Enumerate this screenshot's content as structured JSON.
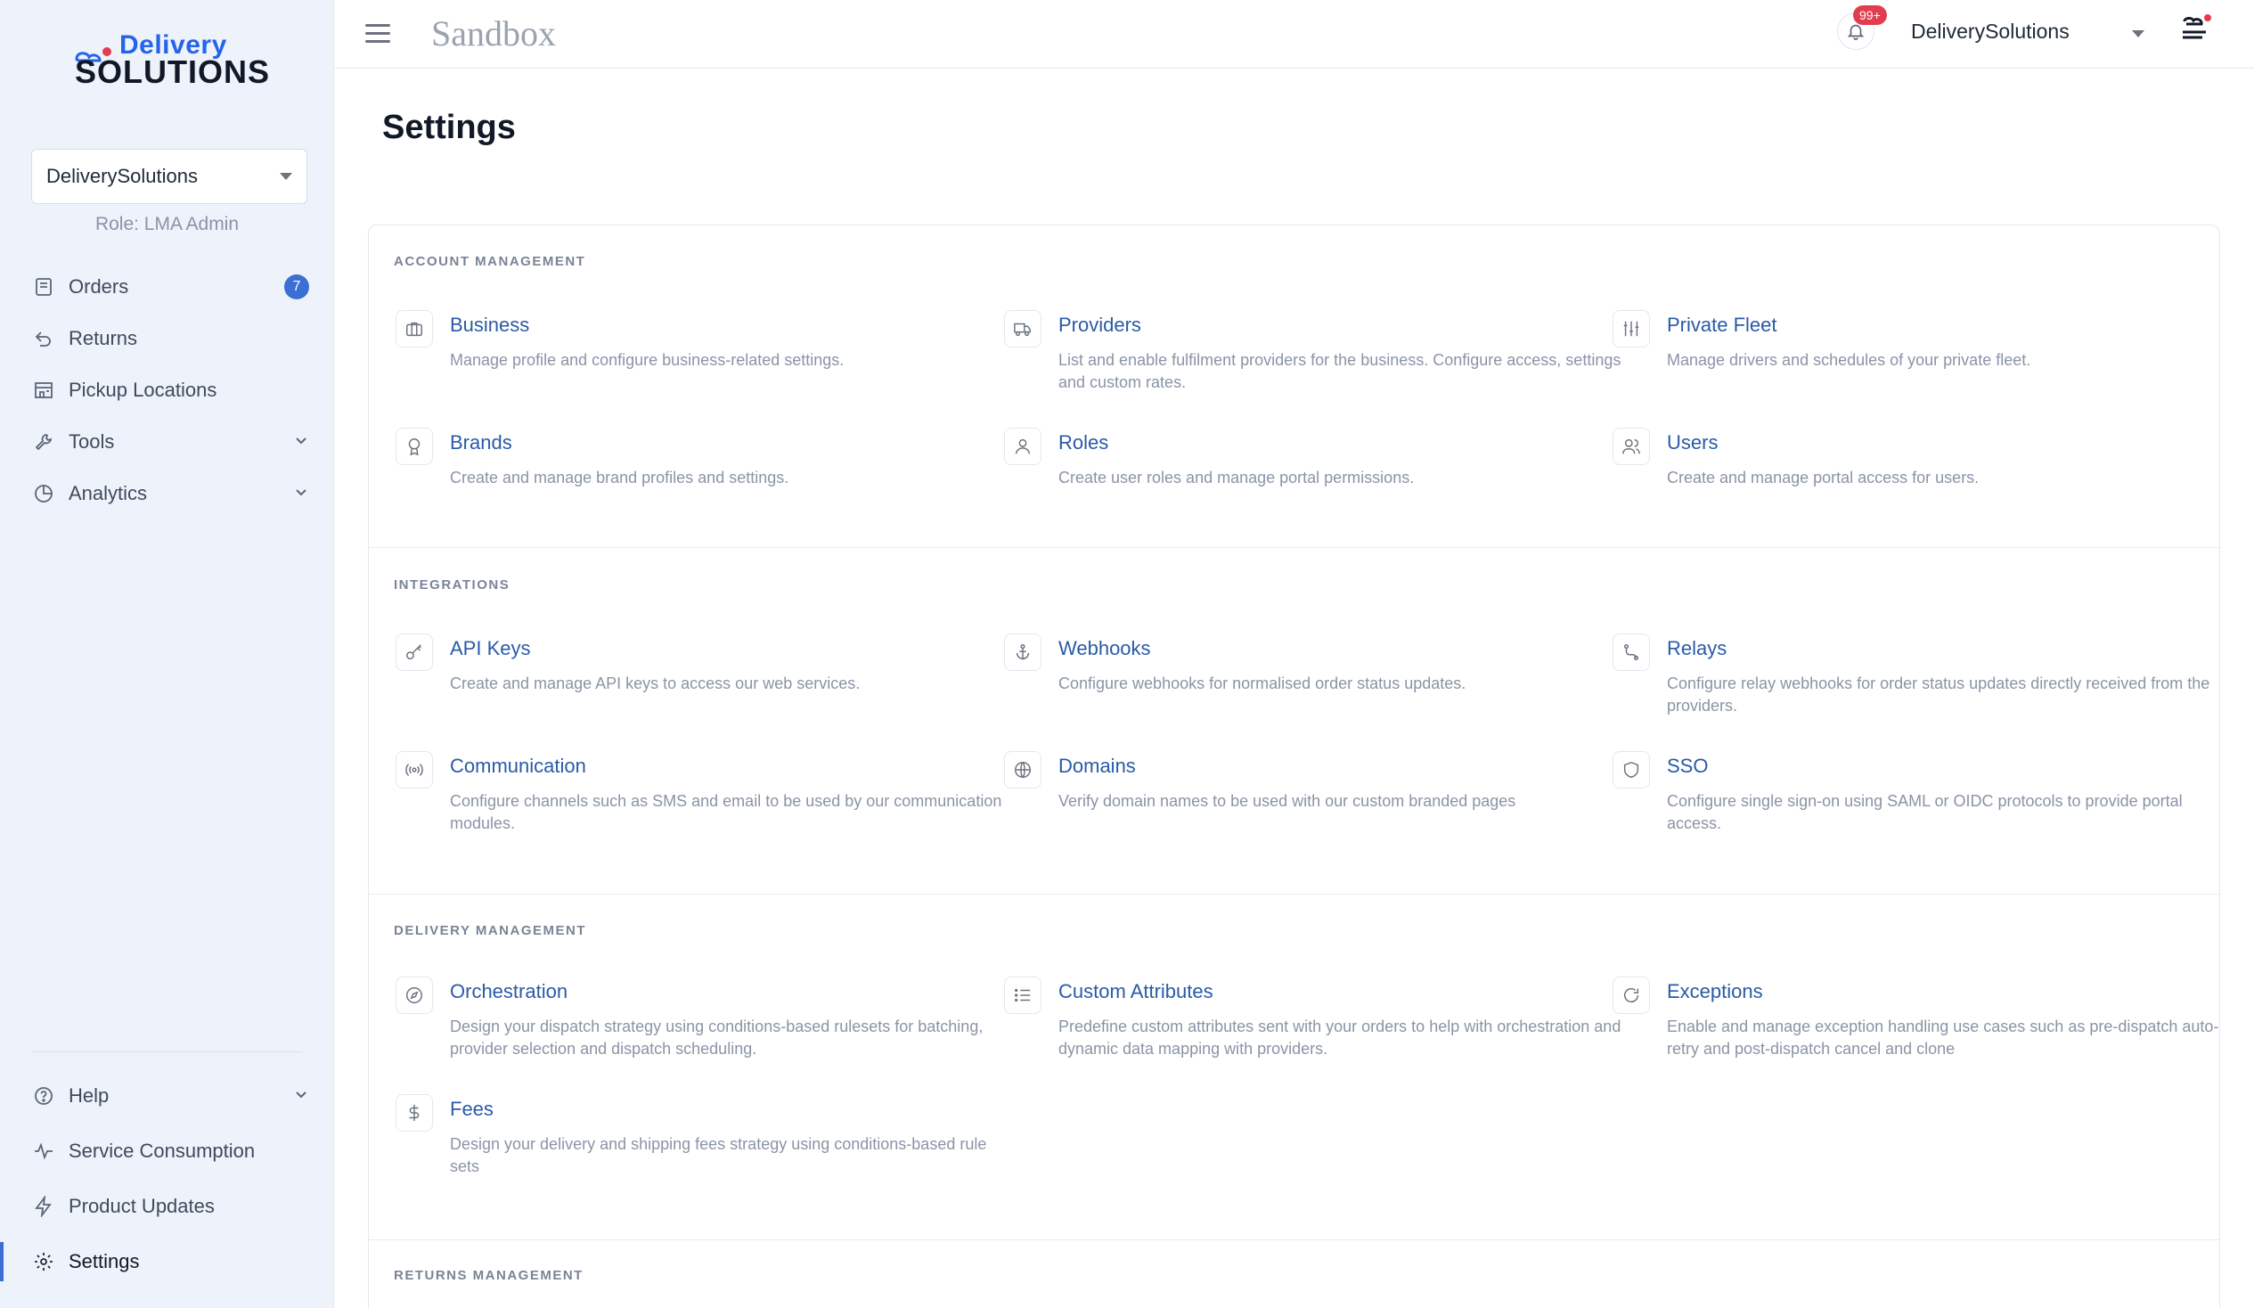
{
  "brand": {
    "logo_top": "Delivery",
    "logo_bottom": "SOLUTIONS"
  },
  "sidebar": {
    "account_select": "DeliverySolutions",
    "role": "Role: LMA Admin",
    "items": [
      {
        "label": "Orders",
        "icon": "orders-icon",
        "badge": "7"
      },
      {
        "label": "Returns",
        "icon": "returns-icon"
      },
      {
        "label": "Pickup Locations",
        "icon": "store-icon"
      },
      {
        "label": "Tools",
        "icon": "wrench-icon"
      },
      {
        "label": "Analytics",
        "icon": "pie-chart-icon"
      }
    ],
    "bottom_items": [
      {
        "label": "Help",
        "icon": "help-icon"
      },
      {
        "label": "Service Consumption",
        "icon": "activity-icon"
      },
      {
        "label": "Product Updates",
        "icon": "lightning-icon"
      },
      {
        "label": "Settings",
        "icon": "gear-icon",
        "active": true
      }
    ]
  },
  "topbar": {
    "environment": "Sandbox",
    "notification_count": "99+",
    "account": "DeliverySolutions"
  },
  "page": {
    "title": "Settings",
    "sections": [
      {
        "label": "ACCOUNT MANAGEMENT",
        "tiles": [
          {
            "name": "Business",
            "desc": "Manage profile and configure business-related settings."
          },
          {
            "name": "Providers",
            "desc": "List and enable fulfilment providers for the business. Configure access, settings and custom rates."
          },
          {
            "name": "Private Fleet",
            "desc": "Manage drivers and schedules of your private fleet."
          },
          {
            "name": "Brands",
            "desc": "Create and manage brand profiles and settings."
          },
          {
            "name": "Roles",
            "desc": "Create user roles and manage portal permissions."
          },
          {
            "name": "Users",
            "desc": "Create and manage portal access for users."
          }
        ]
      },
      {
        "label": "INTEGRATIONS",
        "tiles": [
          {
            "name": "API Keys",
            "desc": "Create and manage API keys to access our web services."
          },
          {
            "name": "Webhooks",
            "desc": "Configure webhooks for normalised order status updates."
          },
          {
            "name": "Relays",
            "desc": "Configure relay webhooks for order status updates directly received from the providers."
          },
          {
            "name": "Communication",
            "desc": "Configure channels such as SMS and email to be used by our communication modules."
          },
          {
            "name": "Domains",
            "desc": "Verify domain names to be used with our custom branded pages"
          },
          {
            "name": "SSO",
            "desc": "Configure single sign-on using SAML or OIDC protocols to provide portal access."
          }
        ]
      },
      {
        "label": "DELIVERY MANAGEMENT",
        "tiles": [
          {
            "name": "Orchestration",
            "desc": "Design your dispatch strategy using conditions-based rulesets for batching, provider selection and dispatch scheduling."
          },
          {
            "name": "Custom Attributes",
            "desc": "Predefine custom attributes sent with your orders to help with orchestration and dynamic data mapping with providers."
          },
          {
            "name": "Exceptions",
            "desc": "Enable and manage exception handling use cases such as pre-dispatch auto-retry and post-dispatch cancel and clone"
          },
          {
            "name": "Fees",
            "desc": "Design your delivery and shipping fees strategy using conditions-based rule sets"
          }
        ]
      },
      {
        "label": "RETURNS MANAGEMENT",
        "tiles": []
      }
    ]
  }
}
